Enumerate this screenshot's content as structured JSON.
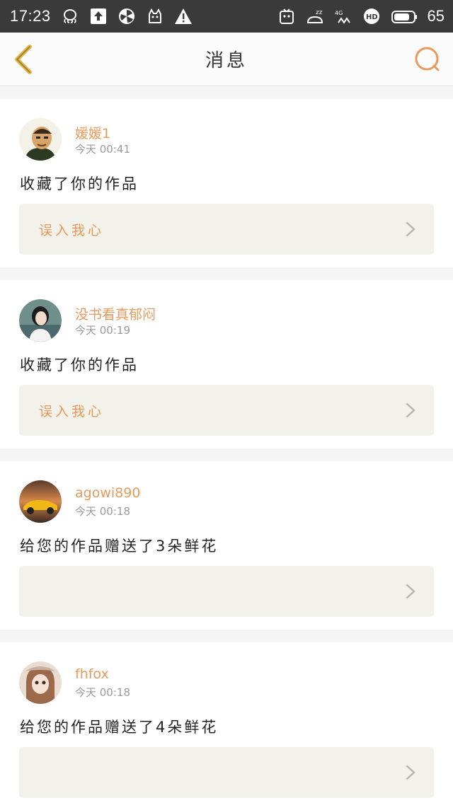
{
  "status_bar": {
    "time": "17:23",
    "battery": "65",
    "left_icons": [
      "octopus-icon",
      "upload-icon",
      "circle-app-icon",
      "cat-icon",
      "warning-icon"
    ],
    "right_icons": [
      "notification-app-icon",
      "sleep-icon",
      "network-4g-icon",
      "hd-icon",
      "battery-icon"
    ]
  },
  "nav": {
    "title": "消息",
    "back_icon": "back-chevron-icon",
    "search_icon": "search-icon",
    "accent_color": "#e79a5b"
  },
  "messages": [
    {
      "username": "媛媛1",
      "time": "今天  00:41",
      "action": "收藏了你的作品",
      "work_title": "误入我心",
      "avatar": "cartoon-man-avatar"
    },
    {
      "username": "没书看真郁闷",
      "time": "今天  00:19",
      "action": "收藏了你的作品",
      "work_title": "误入我心",
      "avatar": "girl-photo-avatar"
    },
    {
      "username": "agowi890",
      "time": "今天  00:18",
      "action": "给您的作品赠送了3朵鲜花",
      "work_title": "",
      "avatar": "sports-car-avatar"
    },
    {
      "username": "fhfox",
      "time": "今天  00:18",
      "action": "给您的作品赠送了4朵鲜花",
      "work_title": "",
      "avatar": "doll-avatar"
    }
  ]
}
